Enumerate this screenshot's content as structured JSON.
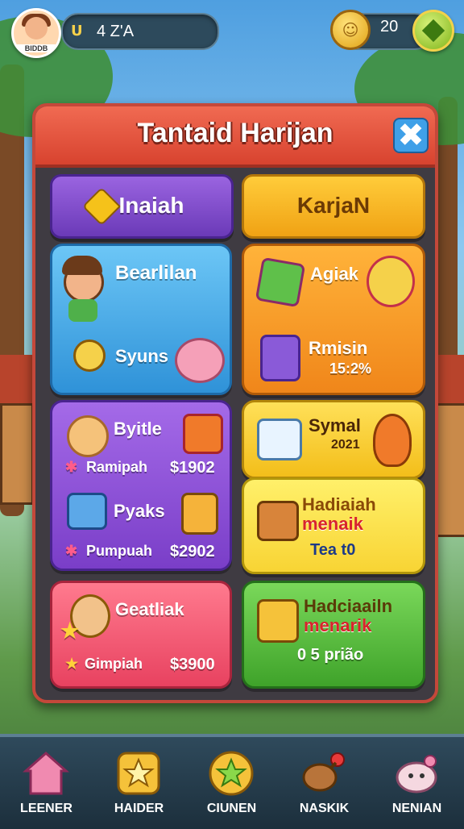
{
  "topbar": {
    "avatar_name": "BIDDB",
    "level_icon": "U",
    "level_text": "4 Z'A",
    "coins": "20"
  },
  "panel": {
    "title": "Tantaid Harijan",
    "close": "✖",
    "tabs": [
      {
        "label": "Inaiah"
      },
      {
        "label": "KarjaN"
      }
    ],
    "cards": {
      "blue": {
        "title": "Bearlilan",
        "sub": "Syuns"
      },
      "orange": {
        "title": "Agiak",
        "sub": "Rmisin",
        "value": "15:2%"
      },
      "purple": {
        "row1_title": "Byitle",
        "row1_label": "Ramipah",
        "row1_price": "$1902",
        "row2_title": "Pyaks",
        "row2_label": "Pumpuah",
        "row2_price": "$2902"
      },
      "yellow": {
        "title": "Symal",
        "value": "2021"
      },
      "yellow2": {
        "title": "Hadiaiah",
        "title2": "menaik",
        "value": "Tea t0"
      },
      "pink": {
        "title": "Geatliak",
        "label": "Gimpiah",
        "price": "$3900"
      },
      "green": {
        "title": "Hadciaailn",
        "title2": "menarik",
        "value": "0 5 prião"
      }
    }
  },
  "nav": [
    {
      "label": "LEENER",
      "icon": "house-icon"
    },
    {
      "label": "HAIDER",
      "icon": "star-icon"
    },
    {
      "label": "CIUNEN",
      "icon": "coin-star-icon"
    },
    {
      "label": "NASKIK",
      "icon": "drumstick-icon"
    },
    {
      "label": "NENIAN",
      "icon": "pet-icon"
    }
  ]
}
